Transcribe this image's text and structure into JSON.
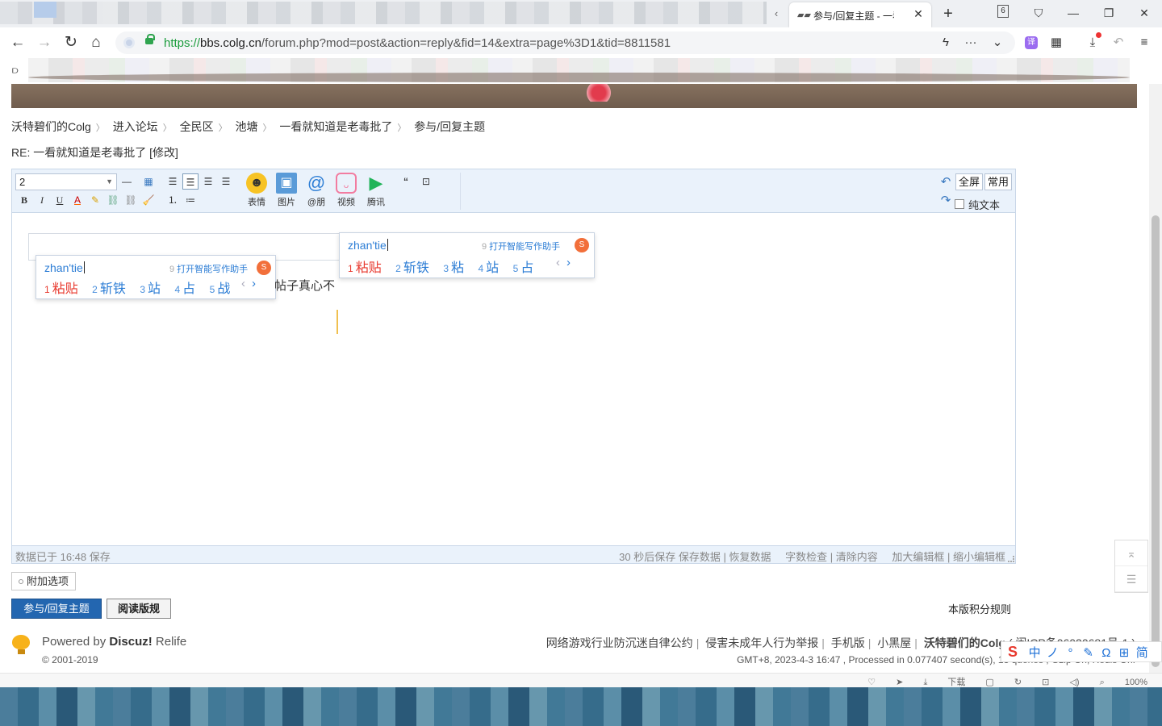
{
  "browser": {
    "active_tab_title": "参与/回复主题 - 一看",
    "tab_count": "6",
    "url_scheme": "https://",
    "url_host": "bbs.colg.cn",
    "url_path": "/forum.php?mod=post&action=reply&fid=14&extra=page%3D1&tid=8811581",
    "status_download": "下载",
    "zoom": "100%"
  },
  "breadcrumb": {
    "items": [
      "沃特碧们的Colg",
      "进入论坛",
      "全民区",
      "池塘",
      "一看就知道是老毒批了",
      "参与/回复主题"
    ]
  },
  "post": {
    "title": "RE: 一看就知道是老毒批了",
    "edit_link": "[修改]"
  },
  "toolbar": {
    "font_size": "2",
    "emoji_label": "表情",
    "image_label": "图片",
    "at_label": "@朋",
    "video_label": "视频",
    "tencent_label": "腾讯",
    "fullscreen_label": "全屏",
    "common_label": "常用",
    "plain_text_label": "纯文本"
  },
  "editor": {
    "body_text": "帖子真心不",
    "saved_status": "数据已于 16:48 保存",
    "autosave": "30 秒后保存",
    "save_data": "保存数据",
    "restore_data": "恢复数据",
    "word_count": "字数检查",
    "clear_content": "清除内容",
    "enlarge": "加大编辑框",
    "shrink": "缩小编辑框"
  },
  "ime": {
    "pinyin": "zhan'tie",
    "assist_num": "9",
    "assist_label": "打开智能写作助手",
    "panel_a": {
      "candidates": [
        {
          "n": "1",
          "text": "粘贴"
        },
        {
          "n": "2",
          "text": "斩铁"
        },
        {
          "n": "3",
          "text": "站"
        },
        {
          "n": "4",
          "text": "占"
        },
        {
          "n": "5",
          "text": "战"
        }
      ]
    },
    "panel_b": {
      "candidates": [
        {
          "n": "1",
          "text": "粘贴"
        },
        {
          "n": "2",
          "text": "斩铁"
        },
        {
          "n": "3",
          "text": "粘"
        },
        {
          "n": "4",
          "text": "站"
        },
        {
          "n": "5",
          "text": "占"
        }
      ]
    },
    "status_items": [
      "中",
      "ノ",
      "°",
      "✎",
      "Ω",
      "⊞",
      "简"
    ]
  },
  "form": {
    "extra_options": "附加选项",
    "submit": "参与/回复主题",
    "read_rules": "阅读版规",
    "credit_rules": "本版积分规则"
  },
  "footer": {
    "powered_by": "Powered by",
    "product": "Discuz!",
    "theme": "Relife",
    "copyright": "© 2001-2019",
    "links": [
      "网络游戏行业防沉迷自律公约",
      "侵害未成年人行为举报",
      "手机版",
      "小黑屋",
      "沃特碧们的Colg"
    ],
    "icp": "( 闽ICP备06020681号-1 )",
    "info": "GMT+8, 2023-4-3 16:47 , Processed in 0.077407 second(s), 13 queries , Gzip On, Redis On."
  }
}
